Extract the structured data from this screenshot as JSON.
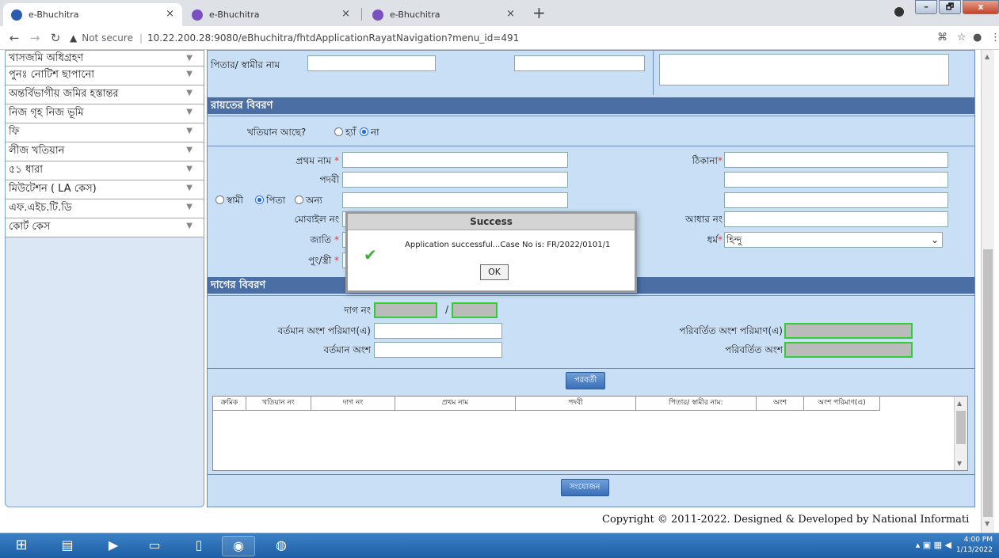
{
  "browser": {
    "tabs": [
      {
        "title": "e-Bhuchitra",
        "active": true
      },
      {
        "title": "e-Bhuchitra",
        "active": false
      },
      {
        "title": "e-Bhuchitra",
        "active": false
      }
    ],
    "new_tab": "+",
    "window_buttons": {
      "minimize": "–",
      "maximize": "🗗",
      "close": "x"
    },
    "address": {
      "security": "Not secure",
      "separator": "|",
      "url": "10.22.200.28:9080/eBhuchitra/fhtdApplicationRayatNavigation?menu_id=491"
    }
  },
  "sidebar": {
    "items": [
      {
        "label": "খাসজমি অধিগ্রহণ"
      },
      {
        "label": "পুনঃ নোটিশ ছাপানো"
      },
      {
        "label": "অন্তর্বিভাগীয় জমির হস্তান্তর"
      },
      {
        "label": "নিজ গৃহ নিজ ভূমি"
      },
      {
        "label": "ফি"
      },
      {
        "label": "লীজ খতিয়ান"
      },
      {
        "label": "৫১ ধারা"
      },
      {
        "label": "মিউটেশন ( LA কেস)"
      },
      {
        "label": "এফ.এইচ.টি.ডি"
      },
      {
        "label": "কোর্ট কেস"
      }
    ]
  },
  "top_form": {
    "father_label": "পিতার/ স্বামীর নাম"
  },
  "rayat_section": {
    "title": "রায়তের বিবরণ",
    "khatian_question": "খতিয়ান আছে?",
    "yes": "হ্যাঁ",
    "no": "না",
    "first_name": "প্রথম নাম",
    "surname": "পদবী",
    "husband": "স্বামী",
    "father": "পিতা",
    "other": "অন্য",
    "mobile": "মোবাইল নং",
    "caste": "জাতি",
    "gender": "পুং/স্ত্রী",
    "address": "ঠিকানা",
    "aadhar": "আধার নং",
    "religion": "ধর্ম",
    "religion_value": "হিন্দু",
    "required_mark": "*"
  },
  "dag_section": {
    "title": "দাগের বিবরণ",
    "dag_no": "দাগ নং",
    "slash": "/",
    "current_area": "বর্তমান অংশ পরিমাণ(এ)",
    "current_share": "বর্তমান অংশ",
    "changed_area": "পরিবর্তিত অংশ পরিমাণ(এ)",
    "changed_share": "পরিবর্তিত অংশ",
    "next_button": "পরবর্তী",
    "table_headers": [
      "ক্রমিক",
      "খতিয়ান নং",
      "দাগ নং",
      "প্রথম নাম",
      "পদবী",
      "পিতার/ স্বামীর নাম:",
      "অংশ",
      "অংশ পরিমাণ(এ)"
    ],
    "add_button": "সংযোজন"
  },
  "dialog": {
    "title": "Success",
    "message": "Application successful...Case No is: FR/2022/0101/1",
    "ok": "OK"
  },
  "footer": {
    "copyright": "Copyright © 2011-2022. Designed & Developed by National Informati"
  },
  "taskbar": {
    "time": "4:00 PM",
    "date": "1/13/2022"
  }
}
